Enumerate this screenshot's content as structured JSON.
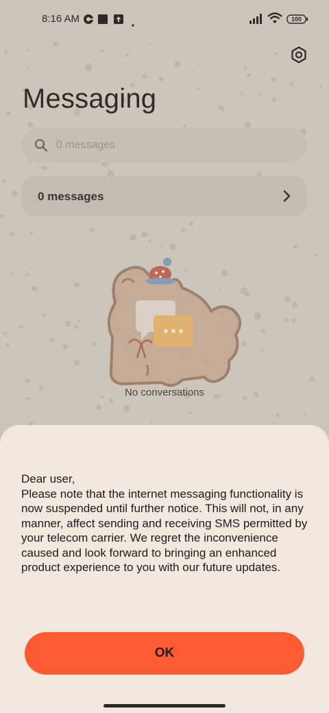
{
  "status_bar": {
    "time": "8:16 AM",
    "battery": "100"
  },
  "header": {
    "title": "Messaging"
  },
  "search": {
    "placeholder": "0 messages"
  },
  "messages_card": {
    "label": "0 messages"
  },
  "empty_state": {
    "text": "No conversations"
  },
  "dialog": {
    "greeting": "Dear user,",
    "body": "Please note that the internet messaging functionality is now suspended until further notice. This will not, in any manner, affect sending and receiving SMS permitted by your telecom carrier. We regret the inconvenience caused and look forward to bringing an enhanced product experience to you with our future updates.",
    "ok_label": "OK"
  },
  "colors": {
    "accent": "#fd5b33",
    "sheet_bg": "#f2e8de",
    "dimmed_bg": "#cdc4ba"
  },
  "icons": [
    "vpn-key-icon",
    "square-notification-icon",
    "upload-notification-icon",
    "signal-icon",
    "wifi-icon",
    "battery-icon",
    "settings-hex-icon",
    "search-icon",
    "chevron-right-icon",
    "chat-bubble-icon"
  ]
}
